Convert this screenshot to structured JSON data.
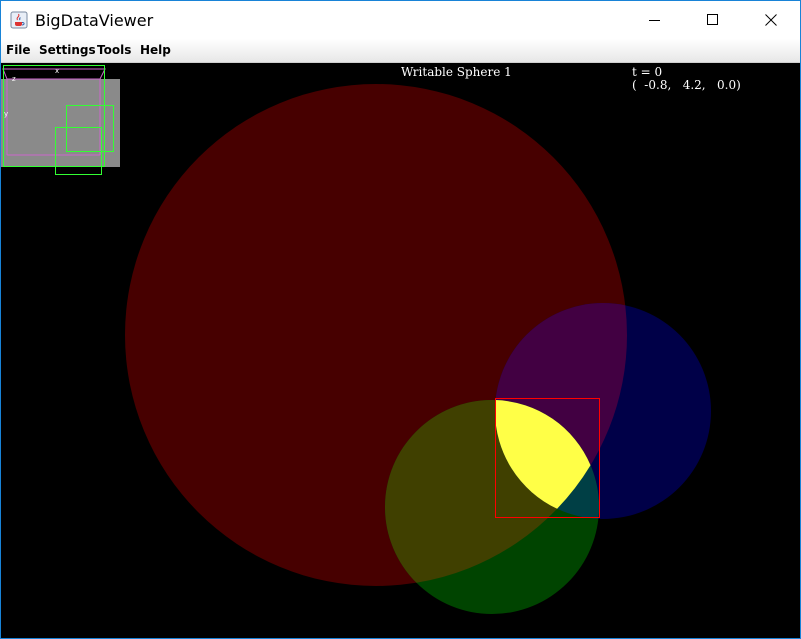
{
  "window": {
    "title": "BigDataViewer",
    "icon": "java-cup-icon",
    "controls": [
      "minimize-icon",
      "maximize-icon",
      "close-icon"
    ]
  },
  "menu": {
    "items": [
      {
        "label": "File"
      },
      {
        "label": "Settings"
      },
      {
        "label": "Tools"
      },
      {
        "label": "Help"
      }
    ]
  },
  "viewer": {
    "source_name": "Writable Sphere 1",
    "timepoint": "t = 0",
    "coordinates": "(  -0.8,   4.2,   0.0)",
    "navigator": {
      "x_label": "x",
      "y_label": "y",
      "z_label": "z"
    },
    "colors": {
      "background": "#000000",
      "sphere_red": "#470000",
      "sphere_blue": "#000048",
      "sphere_green": "#004400",
      "overlap_red_blue": "#420042",
      "overlap_red_green": "#404000",
      "overlap_blue_green": "#003f45",
      "overlap_all": "#ffff47",
      "selection_box": "#ff0000",
      "navigator_box": "#33ff33"
    }
  }
}
